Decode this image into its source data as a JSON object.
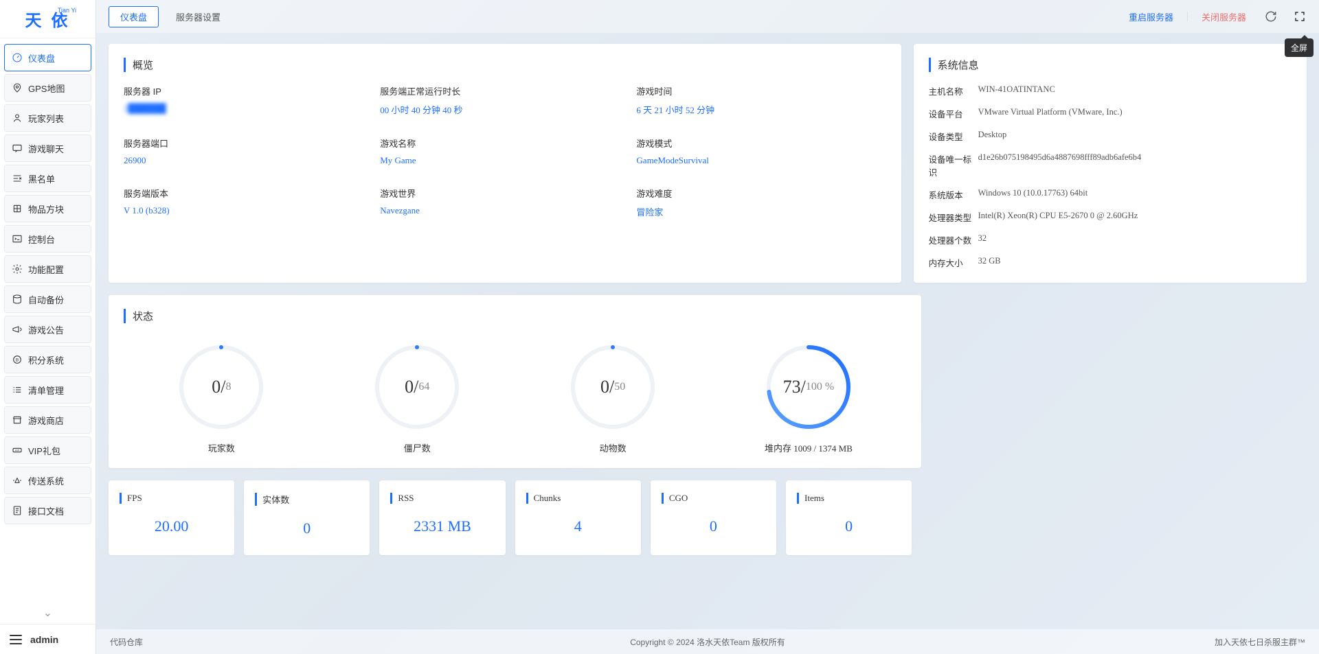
{
  "logo": {
    "text": "天  依",
    "sup": "Tian Yi"
  },
  "sidebar": {
    "items": [
      {
        "label": "仪表盘",
        "icon": "gauge-icon",
        "active": true
      },
      {
        "label": "GPS地图",
        "icon": "pin-icon"
      },
      {
        "label": "玩家列表",
        "icon": "user-icon"
      },
      {
        "label": "游戏聊天",
        "icon": "chat-icon"
      },
      {
        "label": "黑名单",
        "icon": "ban-icon"
      },
      {
        "label": "物品方块",
        "icon": "cube-icon"
      },
      {
        "label": "控制台",
        "icon": "terminal-icon"
      },
      {
        "label": "功能配置",
        "icon": "gear-icon"
      },
      {
        "label": "自动备份",
        "icon": "backup-icon"
      },
      {
        "label": "游戏公告",
        "icon": "megaphone-icon"
      },
      {
        "label": "积分系统",
        "icon": "coin-icon"
      },
      {
        "label": "清单管理",
        "icon": "list-icon"
      },
      {
        "label": "游戏商店",
        "icon": "store-icon"
      },
      {
        "label": "VIP礼包",
        "icon": "vip-icon"
      },
      {
        "label": "传送系统",
        "icon": "teleport-icon"
      },
      {
        "label": "接口文档",
        "icon": "doc-icon"
      }
    ]
  },
  "user": {
    "name": "admin"
  },
  "tabs": [
    {
      "label": "仪表盘",
      "active": true
    },
    {
      "label": "服务器设置",
      "active": false
    }
  ],
  "topActions": {
    "restart": "重启服务器",
    "shutdown": "关闭服务器"
  },
  "tooltip": {
    "fullscreen": "全屏"
  },
  "overview": {
    "title": "概览",
    "items": [
      {
        "label": "服务器 IP",
        "value": "2██████",
        "blurred": true
      },
      {
        "label": "服务端正常运行时长",
        "value": "00 小时 40 分钟 40 秒"
      },
      {
        "label": "游戏时间",
        "value": "6 天 21 小时 52 分钟"
      },
      {
        "label": "服务器端口",
        "value": "26900"
      },
      {
        "label": "游戏名称",
        "value": "My Game"
      },
      {
        "label": "游戏模式",
        "value": "GameModeSurvival"
      },
      {
        "label": "服务端版本",
        "value": "V 1.0 (b328)"
      },
      {
        "label": "游戏世界",
        "value": "Navezgane"
      },
      {
        "label": "游戏难度",
        "value": "冒险家"
      }
    ]
  },
  "systemInfo": {
    "title": "系统信息",
    "rows": [
      {
        "label": "主机名称",
        "value": "WIN-41OATINTANC"
      },
      {
        "label": "设备平台",
        "value": "VMware Virtual Platform (VMware, Inc.)"
      },
      {
        "label": "设备类型",
        "value": "Desktop"
      },
      {
        "label": "设备唯一标识",
        "value": "d1e26b075198495d6a4887698fff89adb6afe6b4"
      },
      {
        "label": "系统版本",
        "value": "Windows 10 (10.0.17763) 64bit"
      },
      {
        "label": "处理器类型",
        "value": "Intel(R) Xeon(R) CPU E5-2670 0 @ 2.60GHz"
      },
      {
        "label": "处理器个数",
        "value": "32"
      },
      {
        "label": "内存大小",
        "value": "32 GB"
      }
    ]
  },
  "state": {
    "title": "状态",
    "rings": [
      {
        "current": "0",
        "max": "8",
        "percent": 0,
        "label": "玩家数"
      },
      {
        "current": "0",
        "max": "64",
        "percent": 0,
        "label": "僵尸数"
      },
      {
        "current": "0",
        "max": "50",
        "percent": 0,
        "label": "动物数"
      },
      {
        "current": "73",
        "max": "100 %",
        "percent": 73,
        "label": "堆内存 1009 / 1374 MB"
      }
    ]
  },
  "stats": [
    {
      "title": "FPS",
      "value": "20.00"
    },
    {
      "title": "实体数",
      "value": "0"
    },
    {
      "title": "RSS",
      "value": "2331 MB"
    },
    {
      "title": "Chunks",
      "value": "4"
    },
    {
      "title": "CGO",
      "value": "0"
    },
    {
      "title": "Items",
      "value": "0"
    }
  ],
  "footer": {
    "left": "代码仓库",
    "center": "Copyright © 2024 洛水天依Team 版权所有",
    "right": "加入天依七日杀服主群™"
  }
}
